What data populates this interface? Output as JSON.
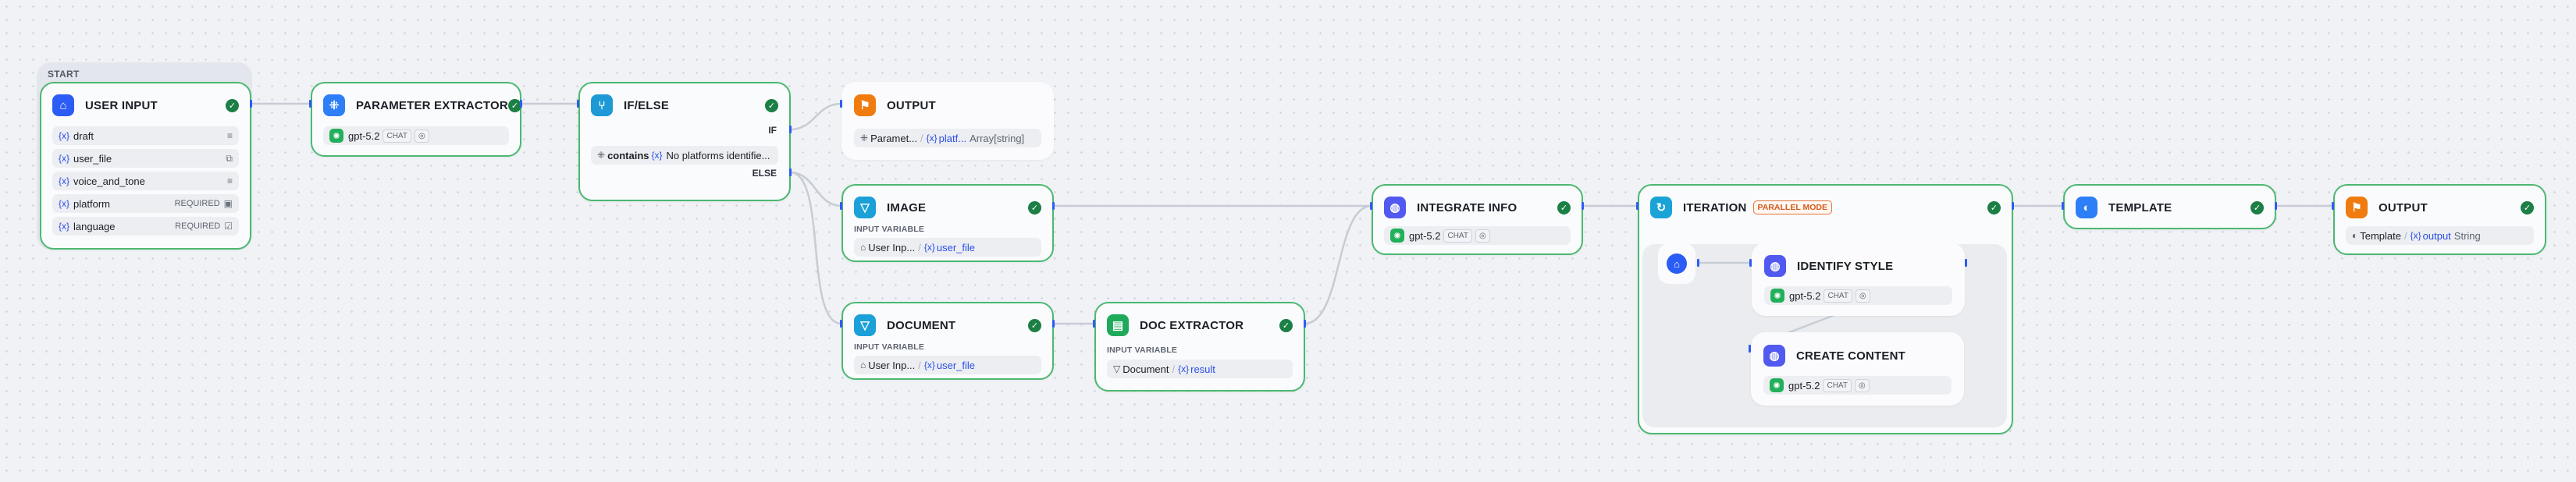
{
  "var_prefix": "{x}",
  "start": {
    "label": "START"
  },
  "user_input": {
    "title": "USER INPUT",
    "vars": [
      {
        "name": "draft",
        "required": "",
        "icon": "paragraph-icon"
      },
      {
        "name": "user_file",
        "required": "",
        "icon": "files-icon"
      },
      {
        "name": "voice_and_tone",
        "required": "",
        "icon": "paragraph-icon"
      },
      {
        "name": "platform",
        "required": "REQUIRED",
        "icon": "text-input-icon"
      },
      {
        "name": "language",
        "required": "REQUIRED",
        "icon": "checkbox-list-icon"
      }
    ]
  },
  "param_extractor": {
    "title": "PARAMETER EXTRACTOR",
    "model": "gpt-5.2",
    "mode": "CHAT"
  },
  "if_else": {
    "title": "IF/ELSE",
    "if_label": "IF",
    "else_label": "ELSE",
    "condition": {
      "operator": "contains",
      "value": "No platforms identifie..."
    }
  },
  "output_1": {
    "title": "OUTPUT",
    "source": "Paramet...",
    "variable": "platf...",
    "type": "Array[string]"
  },
  "image": {
    "title": "IMAGE",
    "section": "INPUT VARIABLE",
    "source": "User Inp...",
    "variable": "user_file"
  },
  "document": {
    "title": "DOCUMENT",
    "section": "INPUT VARIABLE",
    "source": "User Inp...",
    "variable": "user_file"
  },
  "doc_extractor": {
    "title": "DOC EXTRACTOR",
    "section": "INPUT VARIABLE",
    "source": "Document",
    "variable": "result"
  },
  "integrate_info": {
    "title": "INTEGRATE INFO",
    "model": "gpt-5.2",
    "mode": "CHAT"
  },
  "iteration": {
    "title": "ITERATION",
    "badge": "PARALLEL MODE",
    "identify_style": {
      "title": "IDENTIFY STYLE",
      "model": "gpt-5.2",
      "mode": "CHAT"
    },
    "create_content": {
      "title": "CREATE CONTENT",
      "model": "gpt-5.2",
      "mode": "CHAT"
    }
  },
  "template": {
    "title": "TEMPLATE"
  },
  "output_2": {
    "title": "OUTPUT",
    "source": "Template",
    "variable": "output",
    "type": "String"
  },
  "colors": {
    "success_border": "#4cb870",
    "check": "#1c7f45",
    "handle": "#2f5cf6",
    "variable": "#2a4ee8",
    "badge": "#e6743a"
  }
}
